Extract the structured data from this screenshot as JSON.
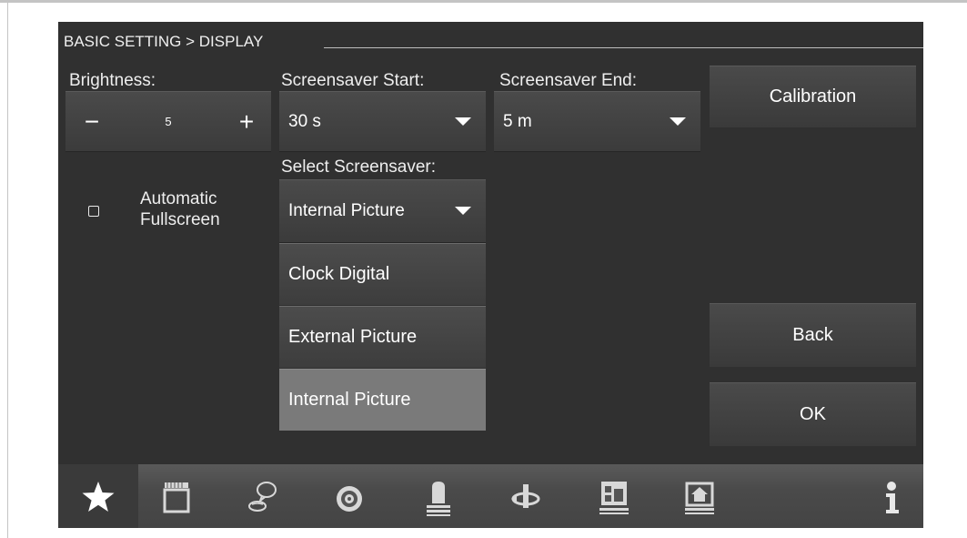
{
  "title": "BASIC SETTING > DISPLAY",
  "brightness": {
    "label": "Brightness:",
    "value": "5",
    "decrease": "−",
    "increase": "+"
  },
  "screensaver_start": {
    "label": "Screensaver Start:",
    "value": "30 s"
  },
  "screensaver_end": {
    "label": "Screensaver End:",
    "value": "5 m"
  },
  "calibration_label": "Calibration",
  "automatic_fullscreen": {
    "line1": "Automatic",
    "line2": "Fullscreen",
    "checked": false
  },
  "select_screensaver": {
    "label": "Select Screensaver:",
    "value": "Internal Picture",
    "options": [
      "Clock Digital",
      "External Picture",
      "Internal Picture"
    ],
    "selected_index": 2
  },
  "back_label": "Back",
  "ok_label": "OK",
  "nav_icons": [
    "star-icon",
    "clapperboard-icon",
    "chat-icon",
    "camera-icon",
    "alarm-light-icon",
    "access-control-icon",
    "building-panel-icon",
    "home-panel-icon",
    "info-icon"
  ],
  "colors": {
    "screen_bg": "#303030",
    "selected_option": "#7a7a7a",
    "text": "#ffffff"
  }
}
